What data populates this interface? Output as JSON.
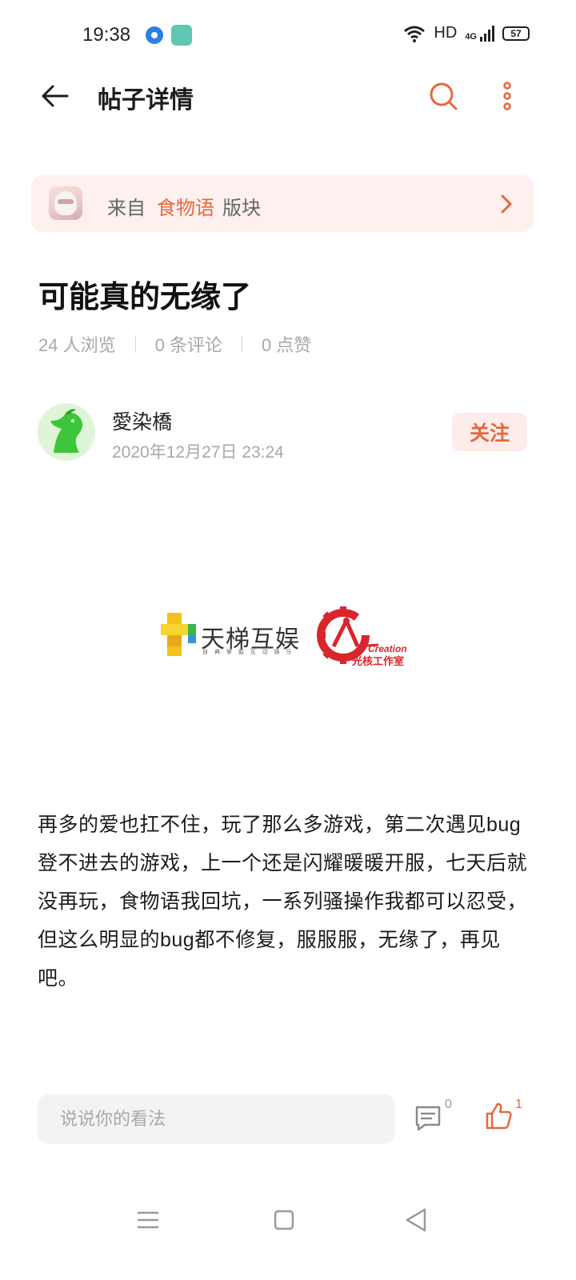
{
  "status_bar": {
    "time": "19:38",
    "network": "HD",
    "signal": "4G",
    "battery": "57"
  },
  "app_bar": {
    "title": "帖子详情",
    "back_icon": "arrow-left-icon",
    "search_icon": "search-icon",
    "more_icon": "more-vertical-icon"
  },
  "board": {
    "from_label": "来自",
    "board_name": "食物语",
    "suffix": "版块"
  },
  "post": {
    "title": "可能真的无缘了",
    "views": "24 人浏览",
    "comments": "0 条评论",
    "likes": "0 点赞",
    "author": {
      "name": "愛染橋",
      "time": "2020年12月27日 23:24",
      "follow_label": "关注"
    },
    "image": {
      "logo_left": "天梯互娱",
      "logo_left_sub": "自 典 掌 握 互 动 娱 乐",
      "logo_right_en": "Creation",
      "logo_right": "光核工作室"
    },
    "body": "再多的爱也扛不住，玩了那么多游戏，第二次遇见bug登不进去的游戏，上一个还是闪耀暖暖开服，七天后就没再玩，食物语我回坑，一系列骚操作我都可以忍受，但这么明显的bug都不修复，服服服，无缘了，再见吧。"
  },
  "bottom_bar": {
    "comment_placeholder": "说说你的看法",
    "comment_count": "0",
    "like_count": "1"
  },
  "colors": {
    "accent": "#e5683e",
    "banner_bg": "#fdf0ef",
    "muted_text": "#a8a8a8"
  }
}
